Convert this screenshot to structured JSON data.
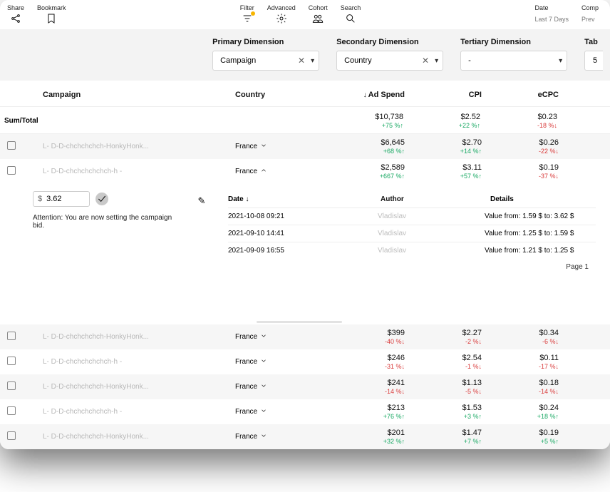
{
  "toolbar": {
    "share": "Share",
    "bookmark": "Bookmark",
    "filter": "Filter",
    "advanced": "Advanced",
    "cohort": "Cohort",
    "search": "Search",
    "date_label": "Date",
    "date_value": "Last 7 Days",
    "comp_label": "Comp",
    "comp_value": "Prev"
  },
  "dimensions": {
    "primary_label": "Primary Dimension",
    "primary_value": "Campaign",
    "secondary_label": "Secondary Dimension",
    "secondary_value": "Country",
    "tertiary_label": "Tertiary Dimension",
    "tertiary_value": "-",
    "tab_label": "Tab",
    "tab_value": "5"
  },
  "columns": {
    "campaign": "Campaign",
    "country": "Country",
    "adspend": "Ad Spend",
    "cpi": "CPI",
    "ecpc": "eCPC"
  },
  "sum": {
    "label": "Sum/Total",
    "adspend": "$10,738",
    "adspend_d": "+75 %↑",
    "adspend_c": "green",
    "cpi": "$2.52",
    "cpi_d": "+22 %↑",
    "cpi_c": "green",
    "ecpc": "$0.23",
    "ecpc_d": "-18 %↓",
    "ecpc_c": "red"
  },
  "rows_top": [
    {
      "name": "L- D-D-chchchchch-HonkyHonk...",
      "country": "France",
      "expand": "down",
      "adspend": "$6,645",
      "adspend_d": "+68 %↑",
      "adspend_c": "green",
      "cpi": "$2.70",
      "cpi_d": "+14 %↑",
      "cpi_c": "green",
      "ecpc": "$0.26",
      "ecpc_d": "-22 %↓",
      "ecpc_c": "red"
    },
    {
      "name": "L- D-D-chchchchchch-h -",
      "country": "France",
      "expand": "up",
      "adspend": "$2,589",
      "adspend_d": "+667 %↑",
      "adspend_c": "green",
      "cpi": "$3.11",
      "cpi_d": "+57 %↑",
      "cpi_c": "green",
      "ecpc": "$0.19",
      "ecpc_d": "-37 %↓",
      "ecpc_c": "red"
    }
  ],
  "bid": {
    "currency": "$",
    "value": "3.62",
    "warning": "Attention: You are now setting the campaign bid."
  },
  "audit": {
    "col_date": "Date",
    "col_author": "Author",
    "col_details": "Details",
    "rows": [
      {
        "date": "2021-10-08 09:21",
        "author": "Vladislav",
        "details": "Value from: 1.59 $ to: 3.62 $"
      },
      {
        "date": "2021-09-10 14:41",
        "author": "Vladislav",
        "details": "Value from: 1.25 $ to: 1.59 $"
      },
      {
        "date": "2021-09-09 16:55",
        "author": "Vladislav",
        "details": "Value from: 1.21 $ to: 1.25 $"
      }
    ],
    "pager": "Page 1"
  },
  "rows_bottom": [
    {
      "name": "L- D-D-chchchchch-HonkyHonk...",
      "country": "France",
      "adspend": "$399",
      "adspend_d": "-40 %↓",
      "adspend_c": "red",
      "cpi": "$2.27",
      "cpi_d": "-2 %↓",
      "cpi_c": "red",
      "ecpc": "$0.34",
      "ecpc_d": "-6 %↓",
      "ecpc_c": "red"
    },
    {
      "name": "L- D-D-chchchchchch-h -",
      "country": "France",
      "adspend": "$246",
      "adspend_d": "-31 %↓",
      "adspend_c": "red",
      "cpi": "$2.54",
      "cpi_d": "-1 %↓",
      "cpi_c": "red",
      "ecpc": "$0.11",
      "ecpc_d": "-17 %↓",
      "ecpc_c": "red"
    },
    {
      "name": "L- D-D-chchchchch-HonkyHonk...",
      "country": "France",
      "adspend": "$241",
      "adspend_d": "-14 %↓",
      "adspend_c": "red",
      "cpi": "$1.13",
      "cpi_d": "-5 %↓",
      "cpi_c": "red",
      "ecpc": "$0.18",
      "ecpc_d": "-14 %↓",
      "ecpc_c": "red"
    },
    {
      "name": "L- D-D-chchchchchch-h -",
      "country": "France",
      "adspend": "$213",
      "adspend_d": "+76 %↑",
      "adspend_c": "green",
      "cpi": "$1.53",
      "cpi_d": "+3 %↑",
      "cpi_c": "green",
      "ecpc": "$0.24",
      "ecpc_d": "+18 %↑",
      "ecpc_c": "green"
    },
    {
      "name": "L- D-D-chchchchch-HonkyHonk...",
      "country": "France",
      "adspend": "$201",
      "adspend_d": "+32 %↑",
      "adspend_c": "green",
      "cpi": "$1.47",
      "cpi_d": "+7 %↑",
      "cpi_c": "green",
      "ecpc": "$0.19",
      "ecpc_d": "+5 %↑",
      "ecpc_c": "green"
    }
  ]
}
